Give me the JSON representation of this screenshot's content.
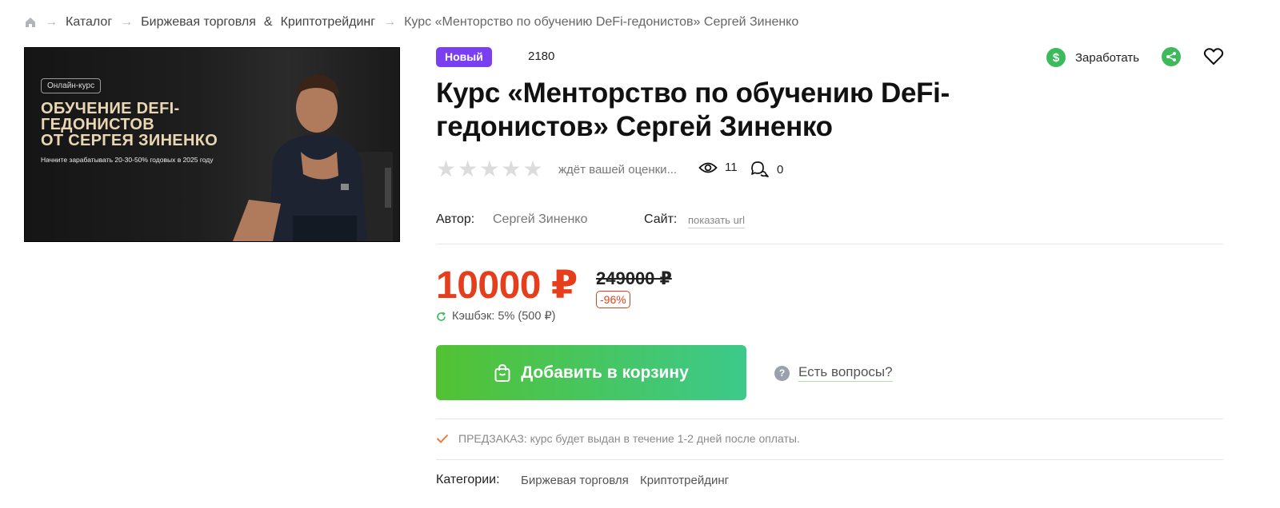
{
  "breadcrumb": {
    "catalog": "Каталог",
    "section_a": "Биржевая торговля",
    "amp": "&",
    "section_b": "Криптотрейдинг",
    "current": "Курс «Менторство по обучению DeFi-гедонистов» Сергей Зиненко"
  },
  "banner": {
    "tag": "Онлайн-курс",
    "line1": "ОБУЧЕНИЕ DEFI-",
    "line2": "ГЕДОНИСТОВ",
    "line3": "ОТ СЕРГЕЯ ЗИНЕНКО",
    "subtitle": "Начните зарабатывать 20-30-50% годовых в 2025 году"
  },
  "badge_new": "Новый",
  "product_number": "2180",
  "earn_label": "Заработать",
  "earn_symbol": "$",
  "title": "Курс «Менторство по обучению DeFi-гедонистов» Сергей Зиненко",
  "rating": {
    "stars": 0,
    "max": 5,
    "label": "ждёт вашей оценки..."
  },
  "views": "11",
  "comments": "0",
  "author": {
    "label": "Автор:",
    "name": "Сергей Зиненко"
  },
  "site": {
    "label": "Сайт:",
    "link": "показать url"
  },
  "price": {
    "current": "10000 ₽",
    "old": "249000 ₽",
    "discount": "-96%"
  },
  "cashback": "Кэшбэк: 5% (500 ₽)",
  "cart_button": "Добавить в корзину",
  "questions": {
    "icon": "?",
    "label": "Есть вопросы?"
  },
  "preorder": "ПРЕДЗАКАЗ: курс будет выдан в течение 1-2 дней после оплаты.",
  "categories": {
    "label": "Категории:",
    "items": [
      "Биржевая торговля",
      "Криптотрейдинг"
    ]
  },
  "colors": {
    "accent_price": "#e63e1c",
    "badge_purple": "#7b3ff2",
    "green": "#3dba5b"
  }
}
